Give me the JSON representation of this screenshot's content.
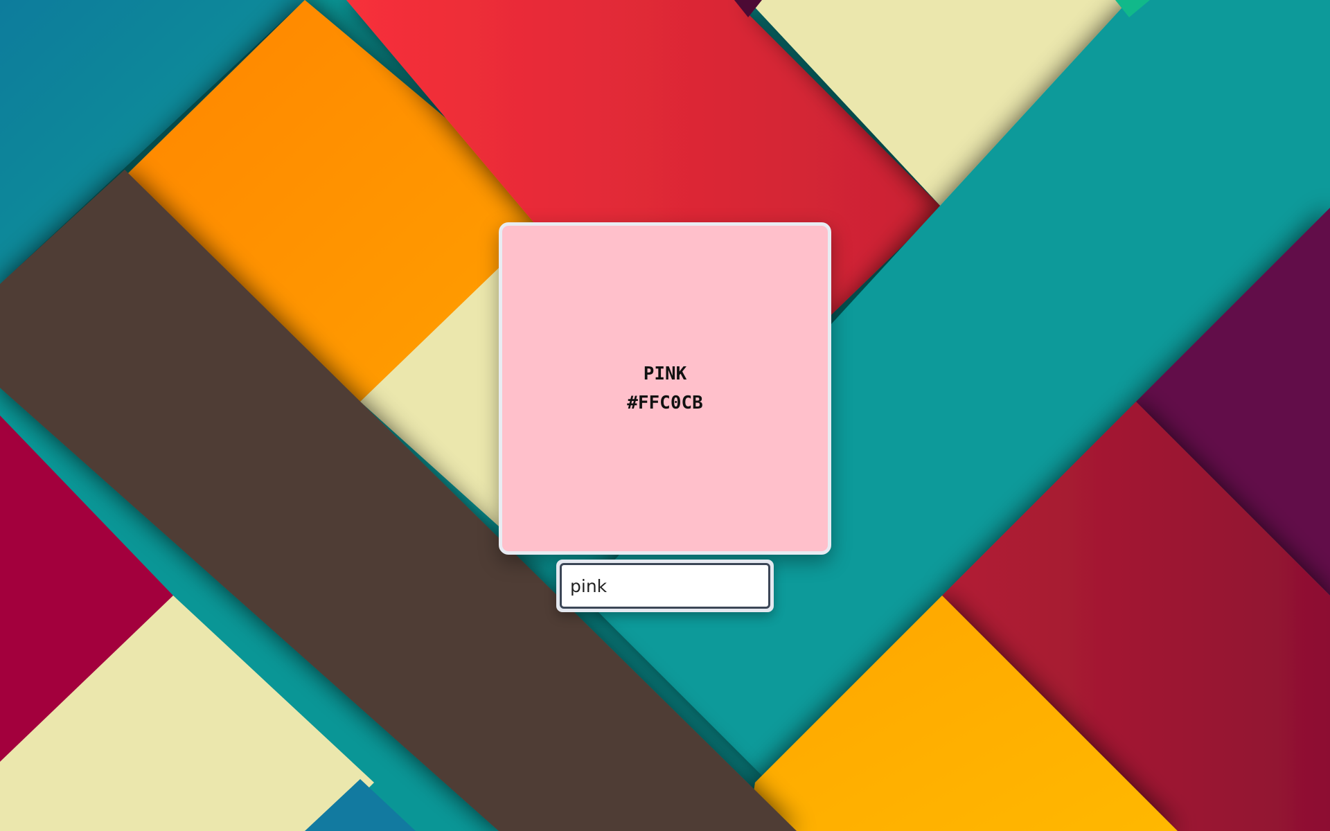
{
  "swatch": {
    "name": "PINK",
    "hex": "#FFC0CB",
    "background_color": "#FFC0CB"
  },
  "color_input": {
    "value": "pink"
  },
  "background": {
    "description_colors": [
      "#0a8f98",
      "#ff8c00",
      "#e5303a",
      "#ebe7ad",
      "#4f3e35",
      "#a3003d",
      "#62104a",
      "#ffb000"
    ]
  }
}
